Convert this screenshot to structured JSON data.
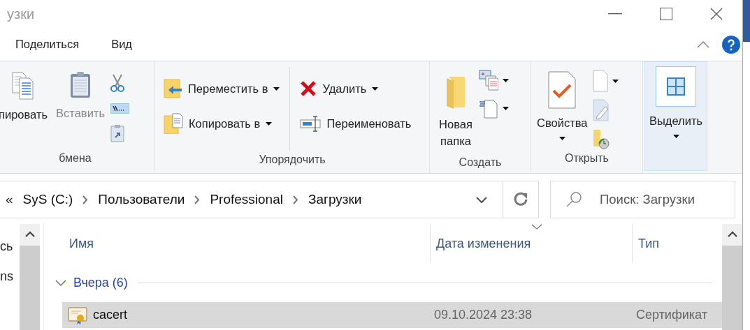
{
  "window": {
    "title": "узки"
  },
  "menu_tabs": [
    {
      "label": "Поделиться",
      "selected": false
    },
    {
      "label": "Вид",
      "selected": false
    }
  ],
  "ribbon": {
    "groups": [
      {
        "label": "бмена",
        "buttons": [
          {
            "label": "пировать",
            "dropdown": false,
            "disabled": false,
            "hovered": false
          },
          {
            "label": "Вставить",
            "dropdown": false,
            "disabled": true,
            "hovered": false
          }
        ],
        "icon_buttons": [
          {
            "dropdown": false
          },
          {
            "dropdown": false
          },
          {
            "dropdown": false
          }
        ]
      },
      {
        "label": "Упорядочить",
        "buttons": [
          {
            "label": "Переместить в",
            "dropdown": true,
            "disabled": false,
            "hovered": false
          },
          {
            "label": "Копировать в",
            "dropdown": true,
            "disabled": false,
            "hovered": false
          },
          {
            "label": "Удалить",
            "dropdown": true,
            "disabled": false,
            "hovered": false
          },
          {
            "label": "Переименовать",
            "dropdown": false,
            "disabled": false,
            "hovered": false
          }
        ]
      },
      {
        "label": "Создать",
        "buttons": [
          {
            "label": "Новая папка",
            "dropdown": false,
            "disabled": false,
            "hovered": false
          }
        ],
        "icon_buttons": [
          {
            "dropdown": true
          },
          {
            "dropdown": true
          }
        ]
      },
      {
        "label": "Открыть",
        "buttons": [
          {
            "label": "Свойства",
            "dropdown": true,
            "disabled": false,
            "hovered": false
          }
        ],
        "icon_buttons": [
          {
            "dropdown": true
          },
          {
            "dropdown": false
          },
          {
            "dropdown": false
          }
        ]
      },
      {
        "buttons": [
          {
            "label": "Выделить",
            "dropdown": true,
            "disabled": false,
            "hovered": true
          }
        ]
      }
    ]
  },
  "address": {
    "overflow": "«",
    "crumbs": [
      "SyS (C:)",
      "Пользователи",
      "Professional",
      "Загрузки"
    ]
  },
  "search": {
    "placeholder": "Поиск: Загрузки"
  },
  "navigation_pane": {
    "items": [
      "сь",
      "ns"
    ]
  },
  "file_list": {
    "columns": [
      {
        "label": "Имя",
        "sorted": false
      },
      {
        "label": "Дата изменения",
        "sorted": true
      },
      {
        "label": "Тип",
        "sorted": false
      }
    ],
    "groups": [
      {
        "label": "Вчера (6)",
        "expanded": true,
        "rows": [
          {
            "name": "cacert",
            "modified": "09.10.2024 23:38",
            "type": "Сертификат",
            "selected": true
          }
        ]
      }
    ]
  }
}
